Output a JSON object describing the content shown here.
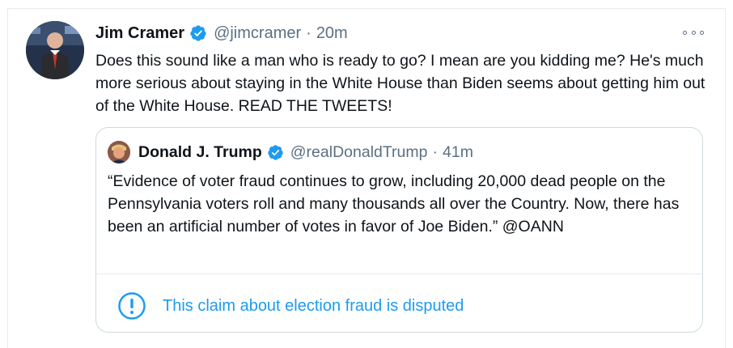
{
  "tweet": {
    "author_name": "Jim Cramer",
    "handle": "@jimcramer",
    "separator": "·",
    "time": "20m",
    "text": "Does this sound like a man who is ready to go? I mean are you kidding me? He's much more serious about staying in the White House than Biden seems about getting him out of the White House. READ THE TWEETS!",
    "avatar_icon": "profile-photo",
    "verified_icon": "verified-badge-icon",
    "more_icon": "more-options-icon"
  },
  "quote": {
    "author_name": "Donald J. Trump",
    "handle": "@realDonaldTrump",
    "separator": "·",
    "time": "41m",
    "text": "“Evidence of voter fraud continues to grow, including 20,000 dead people on the Pennsylvania voters roll and many thousands all over the Country. Now, there has been an artificial number of votes in favor of Joe Biden.” @OANN",
    "notice_text": "This claim about election fraud is disputed",
    "notice_icon": "exclamation-circle-icon"
  },
  "colors": {
    "accent": "#1d9bf0",
    "secondary_text": "#5b7083",
    "border": "#cfd9de"
  }
}
